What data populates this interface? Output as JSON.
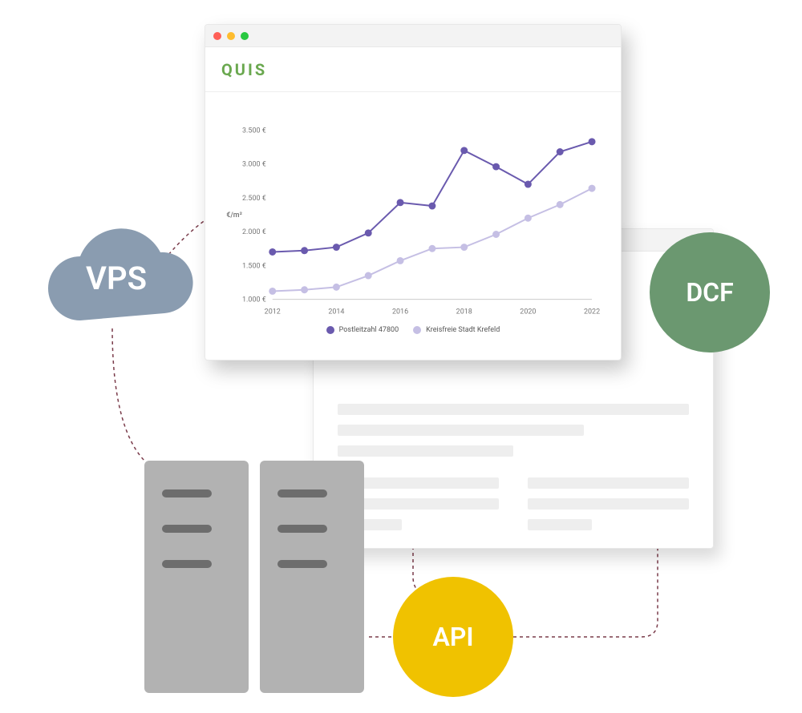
{
  "brand": "QUIS",
  "badges": {
    "vps": "VPS",
    "dcf": "DCF",
    "api": "API"
  },
  "chart_data": {
    "type": "line",
    "title": "",
    "xlabel": "",
    "ylabel": "€/m²",
    "xlim": [
      2012,
      2022
    ],
    "ylim": [
      1000,
      3500
    ],
    "y_ticks": [
      "1.000 €",
      "1.500 €",
      "2.000 €",
      "2.500 €",
      "3.000 €",
      "3.500 €"
    ],
    "x_ticks": [
      "2012",
      "2014",
      "2016",
      "2018",
      "2020",
      "2022"
    ],
    "categories": [
      2012,
      2013,
      2014,
      2015,
      2016,
      2017,
      2018,
      2019,
      2020,
      2021,
      2022
    ],
    "series": [
      {
        "name": "Postleitzahl 47800",
        "values": [
          1700,
          1720,
          1770,
          1980,
          2430,
          2380,
          3200,
          2960,
          2700,
          3180,
          3330
        ]
      },
      {
        "name": "Kreisfreie Stadt Krefeld",
        "values": [
          1120,
          1140,
          1180,
          1350,
          1570,
          1750,
          1770,
          1960,
          2200,
          2400,
          2640
        ]
      }
    ]
  }
}
